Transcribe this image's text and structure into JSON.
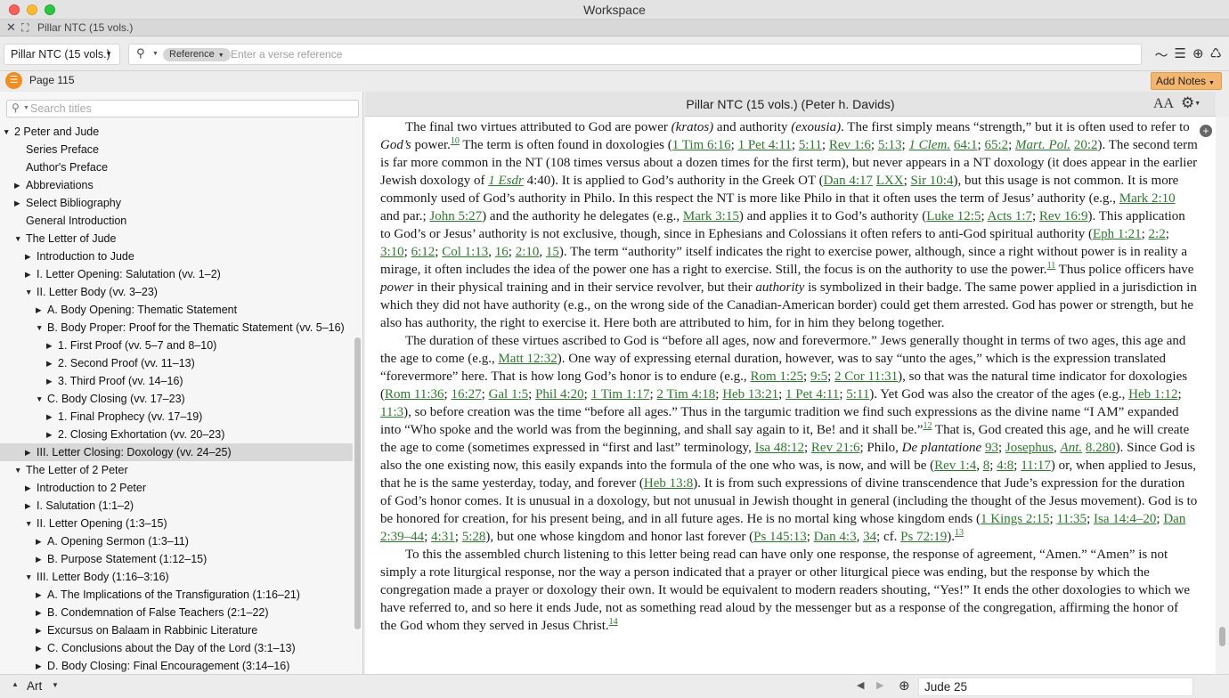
{
  "window": {
    "title": "Workspace"
  },
  "tab": {
    "title": "Pillar NTC (15 vols.)",
    "close_glyph": "✕",
    "expand_glyph": "⛶"
  },
  "toolbar": {
    "resource": "Pillar NTC (15 vols.)",
    "search_mode": "Reference",
    "verse_placeholder": "Enter a verse reference",
    "icons": [
      "waveform-icon",
      "text-list-icon",
      "add-circle-icon",
      "share-icon"
    ]
  },
  "pagebar": {
    "page_label": "Page 115",
    "add_notes": "Add Notes"
  },
  "sidebar": {
    "search_placeholder": "Search titles",
    "toc": [
      {
        "label": "2 Peter and Jude",
        "arrow": "▼"
      },
      {
        "label": "Series Preface",
        "arrow": ""
      },
      {
        "label": "Author's Preface",
        "arrow": ""
      },
      {
        "label": "Abbreviations",
        "arrow": "▶"
      },
      {
        "label": "Select Bibliography",
        "arrow": "▶"
      },
      {
        "label": "General Introduction",
        "arrow": ""
      },
      {
        "label": "The Letter of Jude",
        "arrow": "▼"
      },
      {
        "label": "Introduction to Jude",
        "arrow": "▶"
      },
      {
        "label": "I. Letter Opening: Salutation (vv. 1–2)",
        "arrow": "▶"
      },
      {
        "label": "II. Letter Body (vv. 3–23)",
        "arrow": "▼"
      },
      {
        "label": "A. Body Opening: Thematic Statement",
        "arrow": "▶"
      },
      {
        "label": "B. Body Proper: Proof for the Thematic Statement (vv. 5–16)",
        "arrow": "▼"
      },
      {
        "label": "1. First Proof (vv. 5–7 and 8–10)",
        "arrow": "▶"
      },
      {
        "label": "2. Second Proof (vv. 11–13)",
        "arrow": "▶"
      },
      {
        "label": "3. Third Proof (vv. 14–16)",
        "arrow": "▶"
      },
      {
        "label": "C. Body Closing (vv. 17–23)",
        "arrow": "▼"
      },
      {
        "label": "1. Final Prophecy (vv. 17–19)",
        "arrow": "▶"
      },
      {
        "label": "2. Closing Exhortation (vv. 20–23)",
        "arrow": "▶"
      },
      {
        "label": "III. Letter Closing: Doxology (vv. 24–25)",
        "arrow": "▶"
      },
      {
        "label": "The Letter of 2 Peter",
        "arrow": "▼"
      },
      {
        "label": "Introduction to 2 Peter",
        "arrow": "▶"
      },
      {
        "label": "I. Salutation (1:1–2)",
        "arrow": "▶"
      },
      {
        "label": "II. Letter Opening (1:3–15)",
        "arrow": "▼"
      },
      {
        "label": "A. Opening Sermon (1:3–11)",
        "arrow": "▶"
      },
      {
        "label": "B. Purpose Statement (1:12–15)",
        "arrow": "▶"
      },
      {
        "label": "III. Letter Body (1:16–3:16)",
        "arrow": "▼"
      },
      {
        "label": "A. The Implications of the Transfiguration (1:16–21)",
        "arrow": "▶"
      },
      {
        "label": "B. Condemnation of False Teachers (2:1–22)",
        "arrow": "▶"
      },
      {
        "label": "Excursus on Balaam in Rabbinic Literature",
        "arrow": "▶"
      },
      {
        "label": "C. Conclusions about the Day of the Lord (3:1–13)",
        "arrow": "▶"
      },
      {
        "label": "D. Body Closing: Final Encouragement (3:14–16)",
        "arrow": "▶"
      }
    ]
  },
  "content": {
    "title": "Pillar NTC (15 vols.) (Peter h. Davids)",
    "font_size_label": "AA",
    "paragraphs": [
      [
        {
          "t": "The final two virtues attributed to God are power "
        },
        {
          "t": "(kratos)",
          "i": 1
        },
        {
          "t": " and authority "
        },
        {
          "t": "(exousia)",
          "i": 1
        },
        {
          "t": ". The first simply means “strength,” but it is often used to refer to "
        },
        {
          "t": "God’s",
          "i": 1
        },
        {
          "t": " power."
        },
        {
          "t": "10",
          "s": 1
        },
        {
          "t": " The term is often found in doxologies ("
        },
        {
          "t": "1 Tim 6:16",
          "l": 1
        },
        {
          "t": "; "
        },
        {
          "t": "1 Pet 4:11",
          "l": 1
        },
        {
          "t": "; "
        },
        {
          "t": "5:11",
          "l": 1
        },
        {
          "t": "; "
        },
        {
          "t": "Rev 1:6",
          "l": 1
        },
        {
          "t": "; "
        },
        {
          "t": "5:13",
          "l": 1
        },
        {
          "t": "; "
        },
        {
          "t": "1 Clem.",
          "l": 1,
          "i": 1
        },
        {
          "t": " "
        },
        {
          "t": "64:1",
          "l": 1
        },
        {
          "t": "; "
        },
        {
          "t": "65:2",
          "l": 1
        },
        {
          "t": "; "
        },
        {
          "t": "Mart. Pol.",
          "l": 1,
          "i": 1
        },
        {
          "t": " "
        },
        {
          "t": "20:2",
          "l": 1
        },
        {
          "t": "). The second term is far more common in the NT (108 times versus about a dozen times for the first term), but never appears in a NT doxology (it does appear in the earlier Jewish doxology of "
        },
        {
          "t": "1 Esdr",
          "l": 1,
          "i": 1
        },
        {
          "t": " 4:40). It is applied to God’s authority in the Greek OT ("
        },
        {
          "t": "Dan 4:17",
          "l": 1
        },
        {
          "t": " "
        },
        {
          "t": "LXX",
          "l": 1
        },
        {
          "t": "; "
        },
        {
          "t": "Sir 10:4",
          "l": 1
        },
        {
          "t": "), but this usage is not common. It is more commonly used of God’s authority in Philo. In this respect the NT is more like Philo in that it often uses the term of Jesus’ authority (e.g., "
        },
        {
          "t": "Mark 2:10",
          "l": 1
        },
        {
          "t": " and par.; "
        },
        {
          "t": "John 5:27",
          "l": 1
        },
        {
          "t": ") and the authority he delegates (e.g., "
        },
        {
          "t": "Mark 3:15",
          "l": 1
        },
        {
          "t": ") and applies it to God’s authority ("
        },
        {
          "t": "Luke 12:5",
          "l": 1
        },
        {
          "t": "; "
        },
        {
          "t": "Acts 1:7",
          "l": 1
        },
        {
          "t": "; "
        },
        {
          "t": "Rev 16:9",
          "l": 1
        },
        {
          "t": "). This application to God’s or Jesus’ authority is not exclusive, though, since in Ephesians and Colossians it often refers to anti-God spiritual authority ("
        },
        {
          "t": "Eph 1:21",
          "l": 1
        },
        {
          "t": "; "
        },
        {
          "t": "2:2",
          "l": 1
        },
        {
          "t": "; "
        },
        {
          "t": "3:10",
          "l": 1
        },
        {
          "t": "; "
        },
        {
          "t": "6:12",
          "l": 1
        },
        {
          "t": "; "
        },
        {
          "t": "Col 1:13",
          "l": 1
        },
        {
          "t": ", "
        },
        {
          "t": "16",
          "l": 1
        },
        {
          "t": "; "
        },
        {
          "t": "2:10",
          "l": 1
        },
        {
          "t": ", "
        },
        {
          "t": "15",
          "l": 1
        },
        {
          "t": "). The term “authority” itself indicates the right to exercise power, although, since a right without power is in reality a mirage, it often includes the idea of the power one has a right to exercise. Still, the focus is on the authority to use the power."
        },
        {
          "t": "11",
          "s": 1
        },
        {
          "t": " Thus police officers have "
        },
        {
          "t": "power",
          "i": 1
        },
        {
          "t": " in their physical training and in their service revolver, but their "
        },
        {
          "t": "authority",
          "i": 1
        },
        {
          "t": " is symbolized in their badge. The same power applied in a jurisdiction in which they did not have authority (e.g., on the wrong side of the Canadian-American border) could get them arrested. God has power or strength, but he also has authority, the right to exercise it. Here both are attributed to him, for in him they belong together."
        }
      ],
      [
        {
          "t": "The duration of these virtues ascribed to God is “before all ages, now and forevermore.” Jews generally thought in terms of two ages, this age and the age to come (e.g., "
        },
        {
          "t": "Matt 12:32",
          "l": 1
        },
        {
          "t": "). One way of expressing eternal duration, however, was to say “unto the ages,” which is the expression translated “forevermore” here. That is how long God’s honor is to endure (e.g., "
        },
        {
          "t": "Rom 1:25",
          "l": 1
        },
        {
          "t": "; "
        },
        {
          "t": "9:5",
          "l": 1
        },
        {
          "t": "; "
        },
        {
          "t": "2 Cor 11:31",
          "l": 1
        },
        {
          "t": "), so that was the natural time indicator for doxologies ("
        },
        {
          "t": "Rom 11:36",
          "l": 1
        },
        {
          "t": "; "
        },
        {
          "t": "16:27",
          "l": 1
        },
        {
          "t": "; "
        },
        {
          "t": "Gal 1:5",
          "l": 1
        },
        {
          "t": "; "
        },
        {
          "t": "Phil 4:20",
          "l": 1
        },
        {
          "t": "; "
        },
        {
          "t": "1 Tim 1:17",
          "l": 1
        },
        {
          "t": "; "
        },
        {
          "t": "2 Tim 4:18",
          "l": 1
        },
        {
          "t": "; "
        },
        {
          "t": "Heb 13:21",
          "l": 1
        },
        {
          "t": "; "
        },
        {
          "t": "1 Pet 4:11",
          "l": 1
        },
        {
          "t": "; "
        },
        {
          "t": "5:11",
          "l": 1
        },
        {
          "t": "). Yet God was also the creator of the ages (e.g., "
        },
        {
          "t": "Heb 1:12",
          "l": 1
        },
        {
          "t": "; "
        },
        {
          "t": "11:3",
          "l": 1
        },
        {
          "t": "), so before creation was the time “before all ages.” Thus in the targumic tradition we find such expressions as the divine name “I AM” expanded into “Who spoke and the world was from the beginning, and shall say again to it, Be! and it shall be.”"
        },
        {
          "t": "12",
          "s": 1
        },
        {
          "t": " That is, God created this age, and he will create the age to come (sometimes expressed in “first and last” terminology, "
        },
        {
          "t": "Isa 48:12",
          "l": 1
        },
        {
          "t": "; "
        },
        {
          "t": "Rev 21:6",
          "l": 1
        },
        {
          "t": "; Philo, "
        },
        {
          "t": "De plantatione",
          "i": 1
        },
        {
          "t": " "
        },
        {
          "t": "93",
          "l": 1
        },
        {
          "t": "; "
        },
        {
          "t": "Josephus",
          "l": 1
        },
        {
          "t": ", "
        },
        {
          "t": "Ant.",
          "l": 1,
          "i": 1
        },
        {
          "t": " "
        },
        {
          "t": "8.280",
          "l": 1
        },
        {
          "t": "). Since God is also the one existing now, this easily expands into the formula of the one who was, is now, and will be ("
        },
        {
          "t": "Rev 1:4",
          "l": 1
        },
        {
          "t": ", "
        },
        {
          "t": "8",
          "l": 1
        },
        {
          "t": "; "
        },
        {
          "t": "4:8",
          "l": 1
        },
        {
          "t": "; "
        },
        {
          "t": "11:17",
          "l": 1
        },
        {
          "t": ") or, when applied to Jesus, that he is the same yesterday, today, and forever ("
        },
        {
          "t": "Heb 13:8",
          "l": 1
        },
        {
          "t": "). It is from such expressions of divine transcendence that Jude’s expression for the duration of God’s honor comes. It is unusual in a doxology, but not unusual in Jewish thought in general (including the thought of the Jesus movement). God is to be honored for creation, for his present being, and in all future ages. He is no mortal king whose kingdom ends ("
        },
        {
          "t": "1 Kings 2:15",
          "l": 1
        },
        {
          "t": "; "
        },
        {
          "t": "11:35",
          "l": 1
        },
        {
          "t": "; "
        },
        {
          "t": "Isa 14:4–20",
          "l": 1
        },
        {
          "t": "; "
        },
        {
          "t": "Dan 2:39–44",
          "l": 1
        },
        {
          "t": "; "
        },
        {
          "t": "4:31",
          "l": 1
        },
        {
          "t": "; "
        },
        {
          "t": "5:28",
          "l": 1
        },
        {
          "t": "), but one whose kingdom and honor last forever ("
        },
        {
          "t": "Ps 145:13",
          "l": 1
        },
        {
          "t": "; "
        },
        {
          "t": "Dan 4:3",
          "l": 1
        },
        {
          "t": ", "
        },
        {
          "t": "34",
          "l": 1
        },
        {
          "t": "; cf. "
        },
        {
          "t": "Ps 72:19",
          "l": 1
        },
        {
          "t": ")."
        },
        {
          "t": "13",
          "s": 1
        }
      ],
      [
        {
          "t": "To this the assembled church listening to this letter being read can have only one response, the response of agreement, “Amen.” “Amen” is not simply a rote liturgical response, nor the way a person indicated that a prayer or other liturgical piece was ending, but the response by which the congregation made a prayer or doxology their own. It would be equivalent to modern readers shouting, “Yes!” It ends the other doxologies to which we have referred to, and so here it ends Jude, not as something read aloud by the messenger but as a response of the congregation, affirming the honor of the God whom they served in Jesus Christ."
        },
        {
          "t": "14",
          "s": 1
        }
      ]
    ]
  },
  "statusbar": {
    "art_label": "Art",
    "reference": "Jude 25"
  },
  "colors": {
    "accent": "#f08d1c",
    "link": "#2a7d2a",
    "add_notes_bg": "#f3b66e"
  }
}
